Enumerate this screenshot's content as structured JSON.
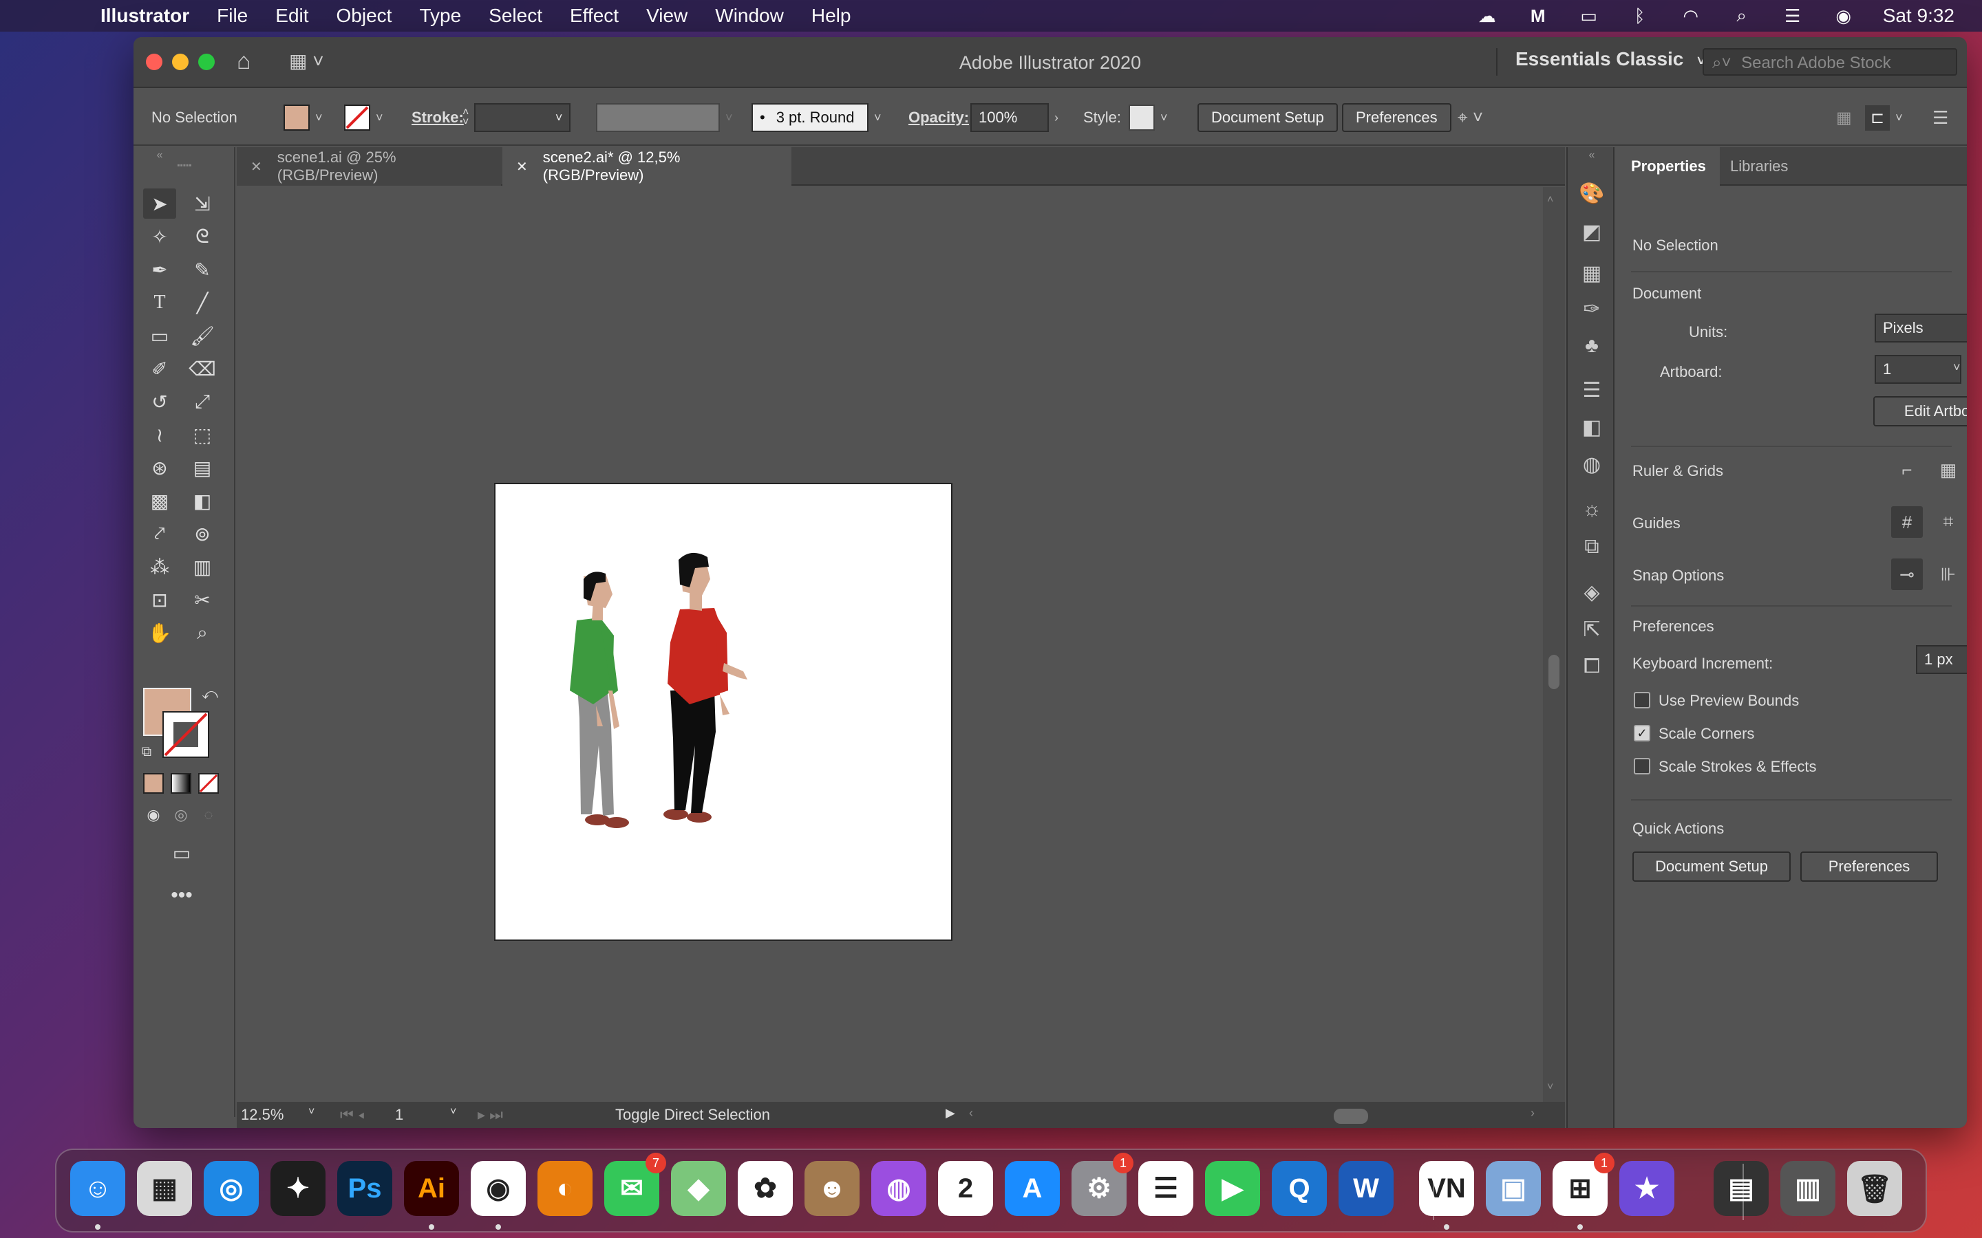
{
  "menubar": {
    "app_name": "Illustrator",
    "menus": [
      "File",
      "Edit",
      "Object",
      "Type",
      "Select",
      "Effect",
      "View",
      "Window",
      "Help"
    ],
    "clock": "Sat 9:32"
  },
  "window": {
    "title": "Adobe Illustrator 2020",
    "workspace": "Essentials Classic",
    "search_placeholder": "Search Adobe Stock"
  },
  "controlbar": {
    "selection": "No Selection",
    "fill_color": "#d7ac93",
    "stroke_label": "Stroke:",
    "brush": "3 pt. Round",
    "opacity_label": "Opacity:",
    "opacity_value": "100%",
    "style_label": "Style:",
    "document_setup": "Document Setup",
    "preferences": "Preferences"
  },
  "tabs": [
    {
      "label": "scene1.ai @ 25% (RGB/Preview)",
      "active": false
    },
    {
      "label": "scene2.ai* @ 12,5% (RGB/Preview)",
      "active": true
    }
  ],
  "statusbar": {
    "zoom": "12.5%",
    "artboard_num": "1",
    "status_text": "Toggle Direct Selection"
  },
  "properties": {
    "tabs": [
      "Properties",
      "Libraries"
    ],
    "selection": "No Selection",
    "document_heading": "Document",
    "units_label": "Units:",
    "units_value": "Pixels",
    "artboard_label": "Artboard:",
    "artboard_value": "1",
    "edit_artboards": "Edit Artboards",
    "ruler_grids": "Ruler & Grids",
    "guides": "Guides",
    "snap_options": "Snap Options",
    "preferences_heading": "Preferences",
    "keyboard_increment_label": "Keyboard Increment:",
    "keyboard_increment_value": "1 px",
    "checkboxes": [
      {
        "label": "Use Preview Bounds",
        "checked": false
      },
      {
        "label": "Scale Corners",
        "checked": true
      },
      {
        "label": "Scale Strokes & Effects",
        "checked": false
      }
    ],
    "quick_actions_heading": "Quick Actions",
    "qa_document_setup": "Document Setup",
    "qa_preferences": "Preferences"
  },
  "artwork": {
    "figure1": {
      "shirt": "#3d9a3f",
      "pants": "#8e8e8e",
      "skin": "#d7ac93",
      "hair": "#111111",
      "shoes": "#8b3a2e"
    },
    "figure2": {
      "shirt": "#c8281f",
      "pants": "#0d0d0d",
      "skin": "#d7ac93",
      "hair": "#111111",
      "shoes": "#8b3a2e"
    }
  },
  "dock": {
    "apps": [
      {
        "name": "Finder",
        "glyph": "☺",
        "color": "#2a8cf0"
      },
      {
        "name": "Launchpad",
        "glyph": "▦",
        "color": "#d9d9d9"
      },
      {
        "name": "Safari",
        "glyph": "◎",
        "color": "#1e88e5"
      },
      {
        "name": "Figma",
        "glyph": "✦",
        "color": "#1e1e1e"
      },
      {
        "name": "Photoshop",
        "glyph": "Ps",
        "color": "#0a2540"
      },
      {
        "name": "Illustrator",
        "glyph": "Ai",
        "color": "#330000"
      },
      {
        "name": "Chrome",
        "glyph": "◉",
        "color": "#ffffff"
      },
      {
        "name": "Blender",
        "glyph": "◐",
        "color": "#e87d0d"
      },
      {
        "name": "Messages",
        "glyph": "✉",
        "color": "#34c759",
        "badge": "7"
      },
      {
        "name": "Maps",
        "glyph": "◆",
        "color": "#7bc67b"
      },
      {
        "name": "Photos",
        "glyph": "✿",
        "color": "#ffffff"
      },
      {
        "name": "Contacts",
        "glyph": "☻",
        "color": "#a27a4f"
      },
      {
        "name": "Podcasts",
        "glyph": "◍",
        "color": "#9b4ee0"
      },
      {
        "name": "Calendar",
        "glyph": "2",
        "color": "#ffffff"
      },
      {
        "name": "App Store",
        "glyph": "A",
        "color": "#1a8cff"
      },
      {
        "name": "System Preferences",
        "glyph": "⚙",
        "color": "#8e8e93",
        "badge": "1"
      },
      {
        "name": "Reminders",
        "glyph": "☰",
        "color": "#ffffff"
      },
      {
        "name": "FaceTime",
        "glyph": "▶",
        "color": "#34c759"
      },
      {
        "name": "QuickTime",
        "glyph": "Q",
        "color": "#1c75d0"
      },
      {
        "name": "Word",
        "glyph": "W",
        "color": "#1d5bb8"
      },
      {
        "name": "VN",
        "glyph": "VN",
        "color": "#ffffff"
      },
      {
        "name": "Preview",
        "glyph": "▣",
        "color": "#7da6d8"
      },
      {
        "name": "Microsoft Office",
        "glyph": "⊞",
        "color": "#ffffff",
        "badge": "1"
      },
      {
        "name": "iMovie",
        "glyph": "★",
        "color": "#6e4ad8"
      },
      {
        "name": "Recent 1",
        "glyph": "▤",
        "color": "#333333"
      },
      {
        "name": "Recent 2",
        "glyph": "▥",
        "color": "#555555"
      },
      {
        "name": "Trash",
        "glyph": "🗑",
        "color": "#d0d0d0"
      }
    ]
  }
}
